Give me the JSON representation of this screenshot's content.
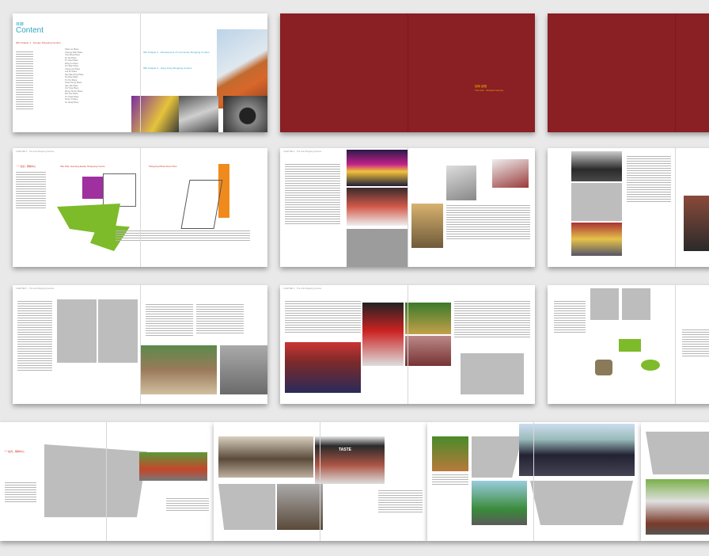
{
  "contents_page": {
    "label_cn": "目錄",
    "label_en": "Content",
    "sections": [
      {
        "no": "006",
        "title": "Chapter 1 · Foreign Shopping Centres"
      },
      {
        "no": "054",
        "title": "Chapter 2 · Development of Community Shopping Centres"
      },
      {
        "no": "086",
        "title": "Chapter 3 · Hong Kong Shopping Centres"
      }
    ],
    "list_items": [
      "Shek Lei Place",
      "Cheung Wah Place",
      "Choi Ming Place",
      "Po Tat Place",
      "Tin Shui Place",
      "Wing Fu Place",
      "Tsz Wan Place",
      "Chung On Place",
      "Lok Fu Place",
      "Sau Mau Ping Place",
      "Tai Hing Place",
      "Tin Tsz Place",
      "Kwai Chung Place",
      "Hau Tak Place",
      "Yat Tung Place",
      "Wong Tai Sin Place",
      "Wo Che Place",
      "Tin Chak Place",
      "Tsing Yi Place",
      "Fu Heng Place"
    ]
  },
  "cover_pages": [
    {
      "caption_cn": "回味·啟程",
      "caption_en": "The Link · Onward Journey"
    }
  ],
  "page_tags": {
    "site_plan": "Site Plan Housing Estate Shopping Centre",
    "site_plan_2": "Shopping Plaza Floor Plan",
    "spread_header": "CHAPTER 1 · The Link Shopping Centres",
    "quote_1": "「一站式」購物中心",
    "sign_text": "TASTE"
  }
}
